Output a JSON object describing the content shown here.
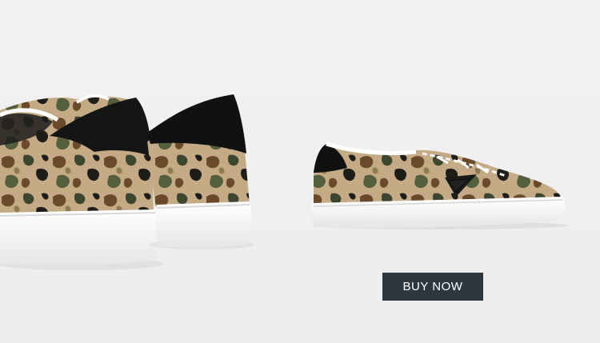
{
  "banner": {
    "background_color": "#efefef",
    "product_image": "camo-sneaker-pair-icon",
    "cta": {
      "label": "BUY NOW",
      "background_color": "#2c3740",
      "text_color": "#ffffff"
    }
  }
}
